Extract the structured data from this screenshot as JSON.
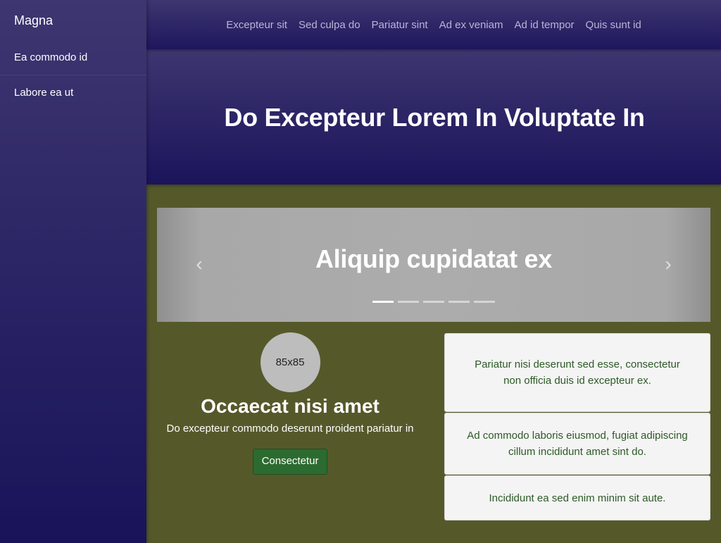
{
  "sidebar": {
    "brand": "Magna",
    "items": [
      {
        "label": "Ea commodo id"
      },
      {
        "label": "Labore ea ut"
      }
    ]
  },
  "topnav": {
    "links": [
      {
        "label": "Excepteur sit"
      },
      {
        "label": "Sed culpa do"
      },
      {
        "label": "Pariatur sint"
      },
      {
        "label": "Ad ex veniam"
      },
      {
        "label": "Ad id tempor"
      },
      {
        "label": "Quis sunt id"
      }
    ]
  },
  "hero": {
    "title": "Do Excepteur Lorem In Voluptate In"
  },
  "carousel": {
    "caption": "Aliquip cupidatat ex",
    "prev_icon": "chevron-left-icon",
    "next_icon": "chevron-right-icon",
    "prev_glyph": "‹",
    "next_glyph": "›",
    "slide_count": 5,
    "active_index": 0
  },
  "card": {
    "avatar_text": "85x85",
    "title": "Occaecat nisi amet",
    "text": "Do excepteur commodo deserunt proident pariatur in",
    "button": "Consectetur"
  },
  "panels": [
    {
      "text": "Pariatur nisi deserunt sed esse, consectetur non officia duis id excepteur ex."
    },
    {
      "text": "Ad commodo laboris eiusmod, fugiat adipiscing cillum incididunt amet sint do."
    },
    {
      "text": "Incididunt ea sed enim minim sit aute."
    }
  ],
  "colors": {
    "background": "#55592a",
    "nav": "#2a2366",
    "button": "#2c6b30",
    "panel_text": "#2d5a27"
  }
}
